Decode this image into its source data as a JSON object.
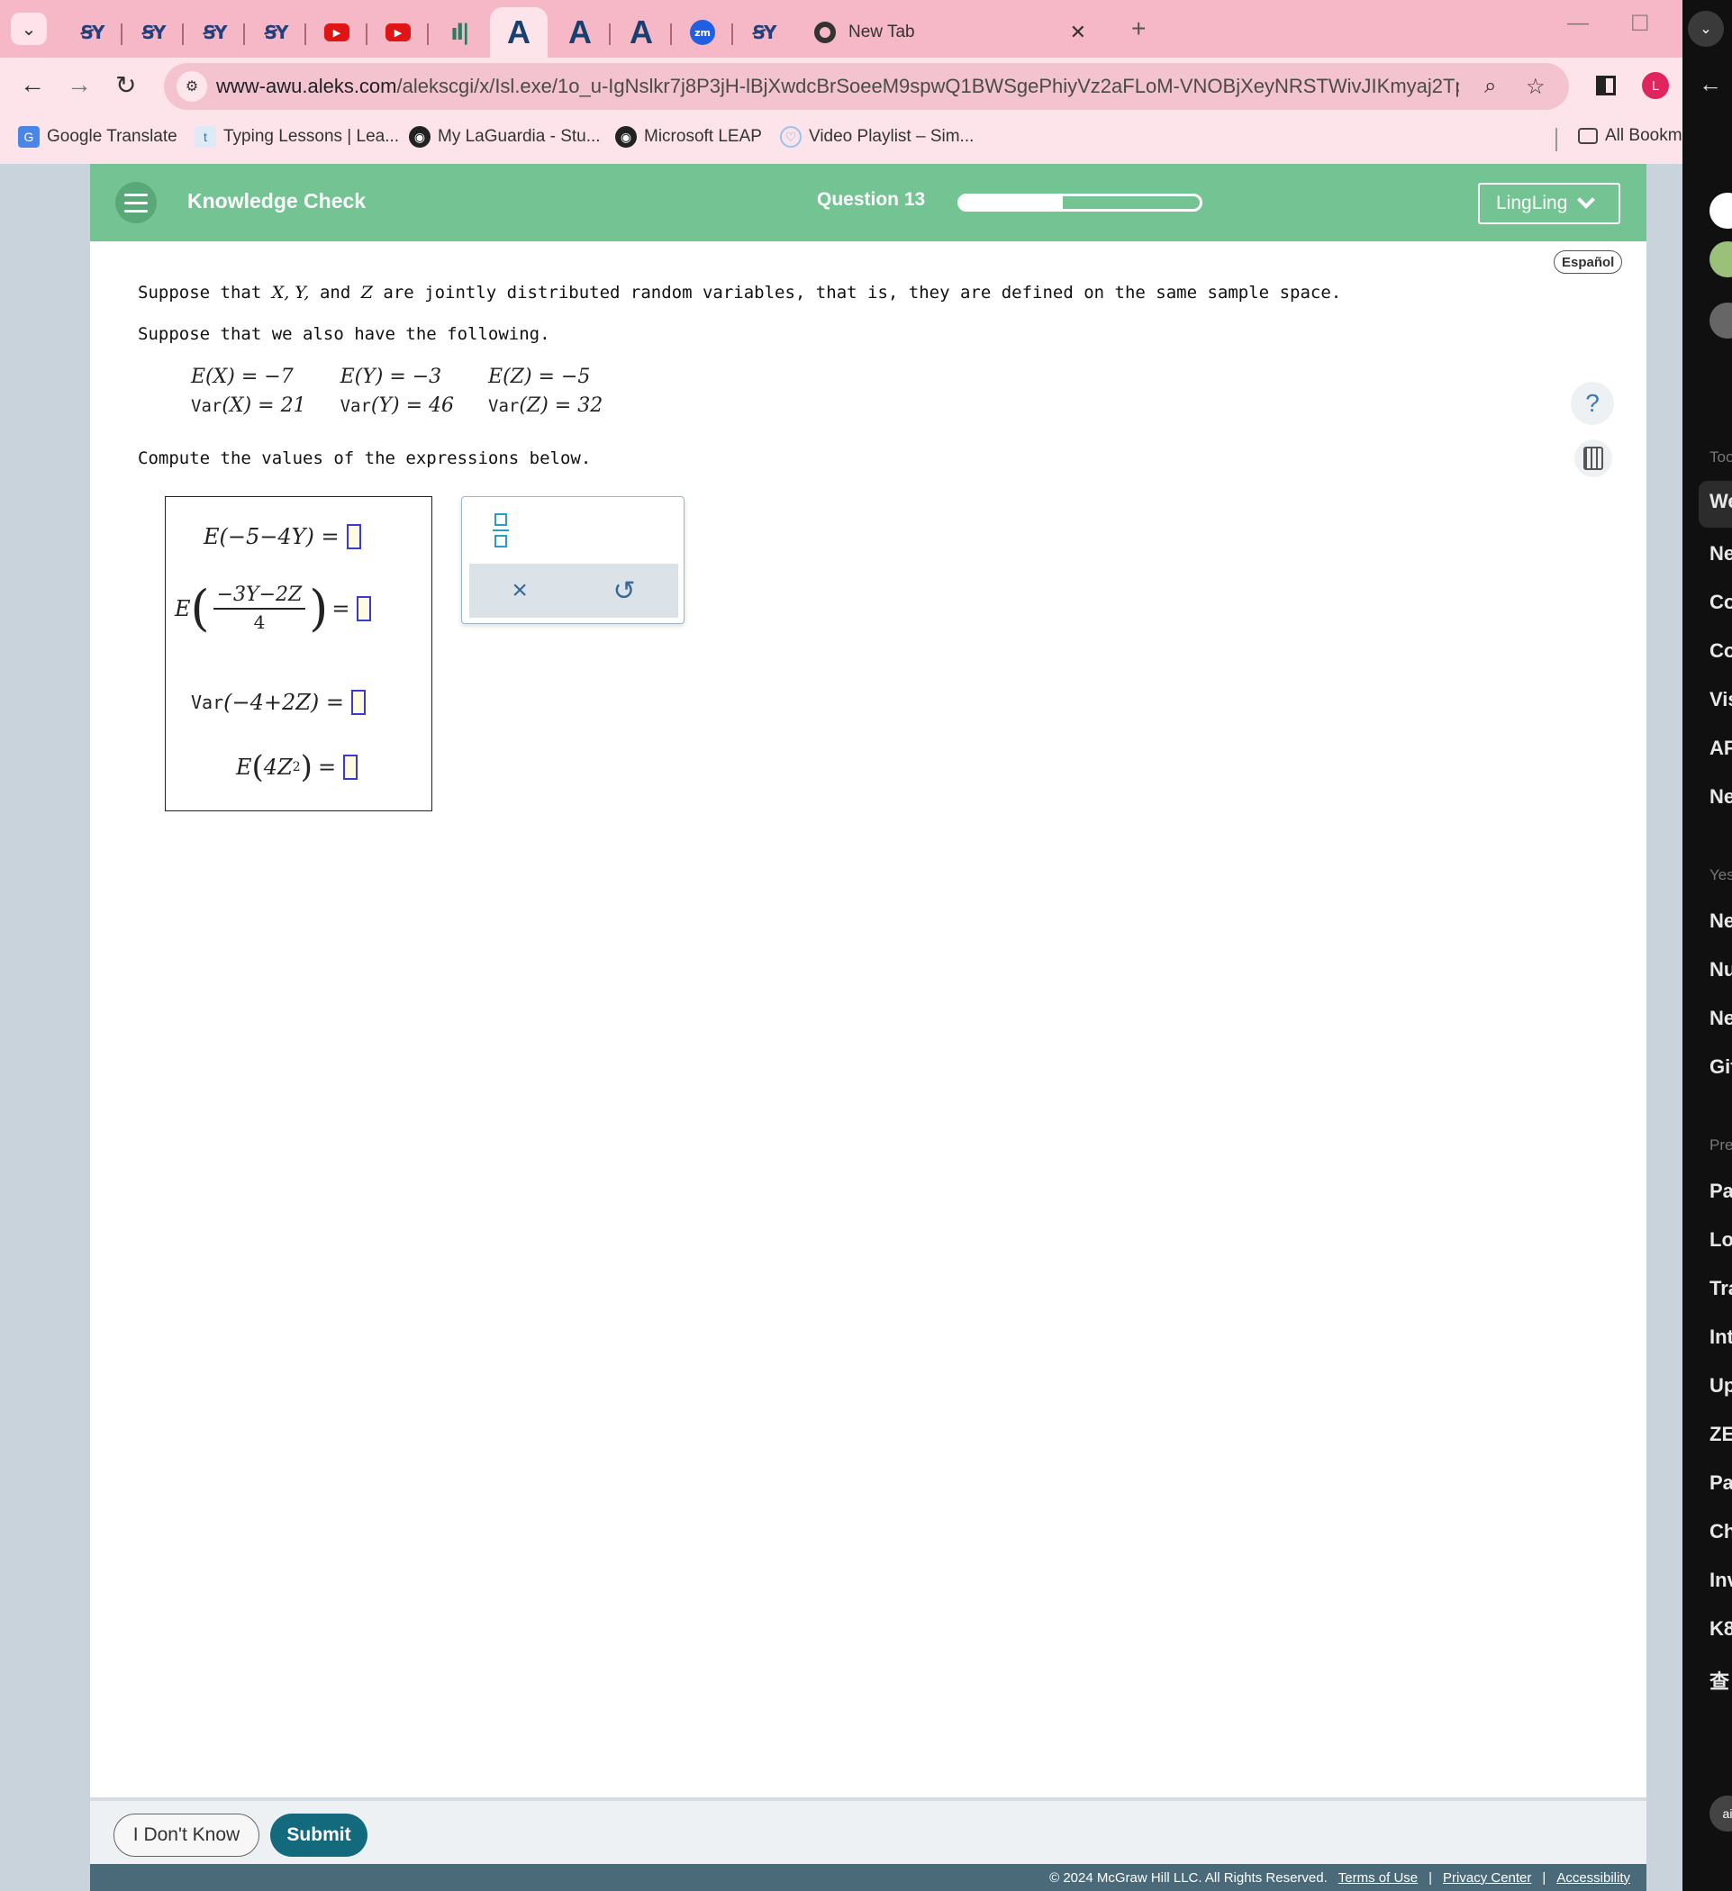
{
  "browser": {
    "tabs": [
      {
        "icon": "cuny-icon",
        "glyph": "CUNY"
      },
      {
        "icon": "cuny-icon",
        "glyph": "CUNY"
      },
      {
        "icon": "cuny-icon",
        "glyph": "CUNY"
      },
      {
        "icon": "cuny-icon",
        "glyph": "CUNY"
      },
      {
        "icon": "youtube-icon",
        "glyph": "▶"
      },
      {
        "icon": "youtube-icon",
        "glyph": "▶"
      },
      {
        "icon": "bars-icon",
        "glyph": "ıll"
      },
      {
        "icon": "aleks-icon",
        "glyph": "A"
      },
      {
        "icon": "aleks-icon",
        "glyph": "A"
      },
      {
        "icon": "aleks-icon",
        "glyph": "A"
      },
      {
        "icon": "zoom-icon",
        "glyph": "zm"
      },
      {
        "icon": "cuny-icon",
        "glyph": "CUNY"
      }
    ],
    "new_tab_title": "New Tab",
    "url_host": "www-awu.aleks.com",
    "url_rest": "/alekscgi/x/Isl.exe/1o_u-IgNslkr7j8P3jH-lBjXwdcBrSoeeM9spwQ1BWSgePhiyVz2aFLoM-VNOBjXeyNRSTWivJIKmyaj2TpdrBS1JZLy...",
    "profile_initial": "L",
    "bookmarks": [
      "Google Translate",
      "Typing Lessons | Lea...",
      "My LaGuardia - Stu...",
      "Microsoft LEAP",
      "Video Playlist – Sim..."
    ],
    "all_bookmarks": "All Bookm"
  },
  "side_panel": {
    "items": [
      "Too",
      "We",
      "Ne",
      "Co",
      "Co",
      "Vis",
      "AP",
      "Ne",
      "Yes",
      "Ne",
      "Nu",
      "Ne",
      "Git",
      "Pre",
      "Pa",
      "Lo",
      "Tra",
      "Int",
      "Up",
      "ZE",
      "Pa",
      "Ch",
      "Inv",
      "K8",
      "查",
      "ai"
    ]
  },
  "header": {
    "title": "Knowledge Check",
    "question_label": "Question 13",
    "progress_fraction": 0.43,
    "user_name": "LingLing",
    "language_button": "Español"
  },
  "question": {
    "intro_1": "Suppose that",
    "intro_vars": "X, Y,",
    "intro_and": "and",
    "intro_z": "Z",
    "intro_2": "are jointly distributed random variables, that is, they are defined on the same sample space.",
    "intro_line2": "Suppose that we also have the following.",
    "given": {
      "ex": "E(X) = −7",
      "ey": "E(Y) = −3",
      "ez": "E(Z) = −5",
      "varx_label": "Var",
      "varx": "(X) = 21",
      "vary_label": "Var",
      "vary": "(Y) = 46",
      "varz_label": "Var",
      "varz": "(Z) = 32"
    },
    "compute_text": "Compute the values of the expressions below.",
    "expressions": {
      "e1": "E(−5−4Y) =",
      "e2_prefix": "E",
      "e2_num": "−3Y−2Z",
      "e2_den": "4",
      "e2_eq": "=",
      "e3_label": "Var",
      "e3": "(−4+2Z) =",
      "e4_prefix": "E",
      "e4_base": "4Z",
      "e4_exp": "2",
      "e4_eq": "="
    }
  },
  "palette": {
    "clear_symbol": "×",
    "undo_symbol": "↺"
  },
  "footer": {
    "idk_label": "I Don't Know",
    "submit_label": "Submit",
    "copyright": "© 2024 McGraw Hill LLC. All Rights Reserved.",
    "terms": "Terms of Use",
    "privacy": "Privacy Center",
    "accessibility": "Accessibility"
  },
  "colors": {
    "header_green": "#73c393",
    "submit_teal": "#136a7d",
    "tab_pink": "#f6b8c6"
  }
}
